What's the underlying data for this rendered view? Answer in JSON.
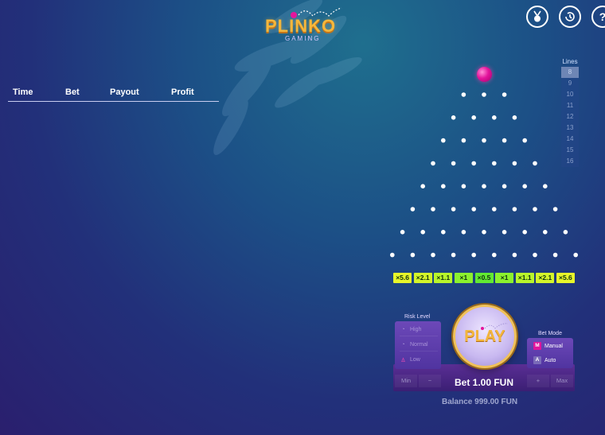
{
  "logo": {
    "title": "PLINKO",
    "subtitle": "GAMING"
  },
  "history": {
    "columns": [
      "Time",
      "Bet",
      "Payout",
      "Profit"
    ]
  },
  "lines": {
    "title": "Lines",
    "options": [
      "8",
      "9",
      "10",
      "11",
      "12",
      "13",
      "14",
      "15",
      "16"
    ],
    "selected": "8"
  },
  "board": {
    "peg_rows": [
      3,
      4,
      5,
      6,
      7,
      8,
      9,
      10
    ],
    "multipliers": [
      "×5.6",
      "×2.1",
      "×1.1",
      "×1",
      "×0.5",
      "×1",
      "×1.1",
      "×2.1",
      "×5.6"
    ],
    "multiplier_colors": [
      "#e7f62a",
      "#d4f52a",
      "#b9f52b",
      "#8cf12e",
      "#62e932",
      "#8cf12e",
      "#b9f52b",
      "#d4f52a",
      "#e7f62a"
    ]
  },
  "risk": {
    "title": "Risk Level",
    "options": [
      {
        "label": "High",
        "icon": "circle-icon"
      },
      {
        "label": "Normal",
        "icon": "circle-icon"
      },
      {
        "label": "Low",
        "icon": "flask-icon",
        "active": true
      }
    ]
  },
  "mode": {
    "title": "Bet Mode",
    "options": [
      {
        "key": "M",
        "label": "Manual",
        "key_color": "#e0159c"
      },
      {
        "key": "A",
        "label": "Auto",
        "key_color": "#7a6bb8"
      }
    ]
  },
  "play": {
    "label": "PLAY"
  },
  "bet": {
    "text": "Bet 1.00 FUN",
    "min": "Min",
    "minus": "−",
    "plus": "+",
    "max": "Max"
  },
  "balance": {
    "text": "Balance 999.00 FUN"
  },
  "icons": [
    "medal-icon",
    "history-icon",
    "help-icon"
  ]
}
